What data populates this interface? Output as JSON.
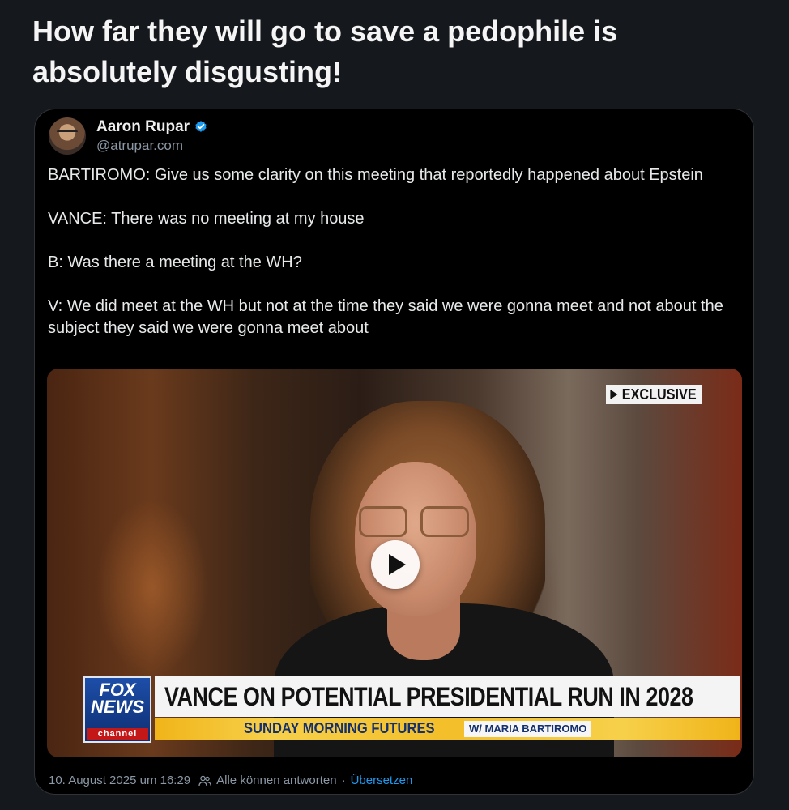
{
  "post": {
    "title": "How far they will go to save a pedophile is absolutely disgusting!"
  },
  "tweet": {
    "author_name": "Aaron Rupar",
    "handle": "@atrupar.com",
    "verified": true,
    "paragraphs": [
      "BARTIROMO: Give us some clarity on this meeting that reportedly happened about Epstein",
      "VANCE: There was no meeting at my house",
      "B: Was there a meeting at the WH?",
      "V: We did meet at the WH but not at the time they said we were gonna meet and not about the subject they said we were gonna meet about"
    ],
    "timestamp": "10. August 2025 um 16:29",
    "reply_setting": "Alle können antworten",
    "separator": "·",
    "translate_link": "Übersetzen"
  },
  "video": {
    "badge": "EXCLUSIVE",
    "network": {
      "line1": "FOX",
      "line2": "NEWS",
      "line3": "channel"
    },
    "headline": "VANCE ON POTENTIAL PRESIDENTIAL RUN IN 2028",
    "show_name": "SUNDAY MORNING FUTURES",
    "host_tag": "W/ MARIA BARTIROMO"
  },
  "colors": {
    "background": "#15181c",
    "card": "#000000",
    "link": "#1d9bf0",
    "verified": "#1d9bf0",
    "muted": "#8b98a5"
  },
  "icons": {
    "verified": "verified-badge-icon",
    "play": "play-icon",
    "reply_setting": "people-icon"
  }
}
